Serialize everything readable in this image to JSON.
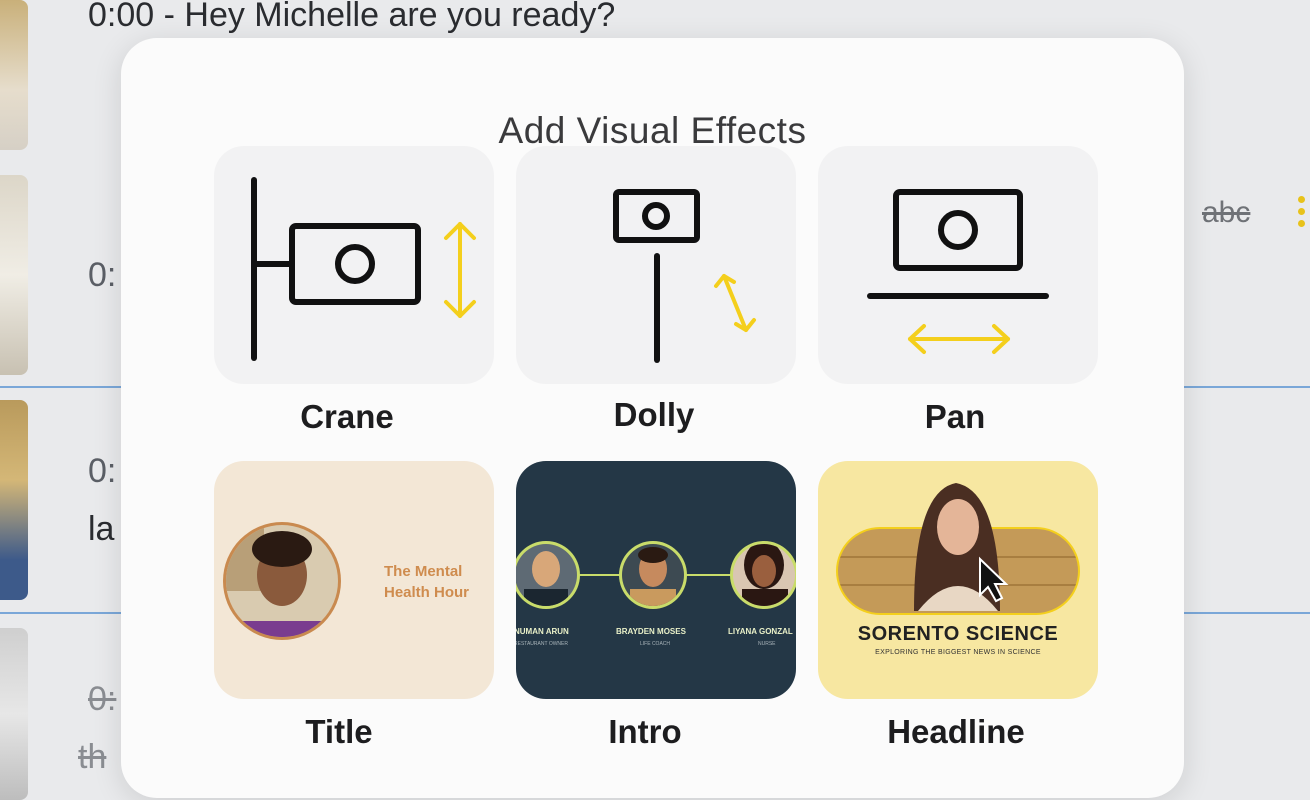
{
  "background": {
    "transcript_first_line": "0:00 - Hey Michelle are you ready?",
    "timestamp_partial_1": "0:",
    "timestamp_partial_2": "0:",
    "text_partial": "la",
    "timestamp_partial_3": "0:",
    "text_partial_2": "th",
    "strike_tag": "abc"
  },
  "modal": {
    "title": "Add Visual Effects",
    "effects": [
      {
        "label": "Crane",
        "icon": "crane-camera-icon"
      },
      {
        "label": "Dolly",
        "icon": "dolly-camera-icon"
      },
      {
        "label": "Pan",
        "icon": "pan-camera-icon"
      },
      {
        "label": "Title",
        "preview_text": "The Mental Health Hour"
      },
      {
        "label": "Intro",
        "people": [
          {
            "name": "NUMAN ARUN",
            "role": "RESTAURANT OWNER"
          },
          {
            "name": "BRAYDEN MOSES",
            "role": "LIFE COACH"
          },
          {
            "name": "LIYANA GONZAL",
            "role": "NURSE"
          }
        ]
      },
      {
        "label": "Headline",
        "preview_title": "SORENTO SCIENCE",
        "preview_subtitle": "EXPLORING THE BIGGEST NEWS IN SCIENCE"
      }
    ]
  },
  "colors": {
    "accent_yellow": "#f4cf1c",
    "icon_stroke": "#111111",
    "intro_bg": "#243746",
    "title_bg": "#f3e7d6",
    "title_text": "#cf8c4e",
    "headline_bg": "#f7e7a1"
  }
}
